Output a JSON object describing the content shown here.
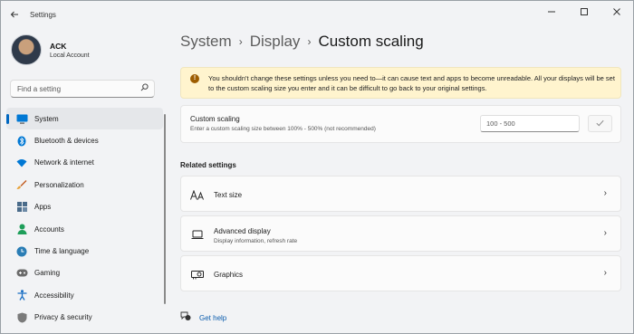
{
  "window": {
    "title": "Settings",
    "back_icon": "back-arrow-icon",
    "controls": [
      "minimize-icon",
      "maximize-icon",
      "close-icon"
    ]
  },
  "profile": {
    "name": "ACK",
    "account_type": "Local Account"
  },
  "search": {
    "placeholder": "Find a setting",
    "icon": "search-icon"
  },
  "sidebar": {
    "items": [
      {
        "label": "System",
        "icon": "monitor-icon",
        "active": true,
        "color": "#0067c0"
      },
      {
        "label": "Bluetooth & devices",
        "icon": "bluetooth-icon",
        "color": "#0078d4"
      },
      {
        "label": "Network & internet",
        "icon": "wifi-icon",
        "color": "#0078d4"
      },
      {
        "label": "Personalization",
        "icon": "brush-icon",
        "color": "#c25b1f"
      },
      {
        "label": "Apps",
        "icon": "apps-icon",
        "color": "#4a6b8a"
      },
      {
        "label": "Accounts",
        "icon": "person-icon",
        "color": "#1e9e5a"
      },
      {
        "label": "Time & language",
        "icon": "globe-clock-icon",
        "color": "#2a7db5"
      },
      {
        "label": "Gaming",
        "icon": "gamepad-icon",
        "color": "#6b6b6b"
      },
      {
        "label": "Accessibility",
        "icon": "accessibility-icon",
        "color": "#1a6fc4"
      },
      {
        "label": "Privacy & security",
        "icon": "shield-icon",
        "color": "#6b6b6b"
      }
    ]
  },
  "breadcrumb": {
    "items": [
      "System",
      "Display",
      "Custom scaling"
    ]
  },
  "warning": {
    "icon": "warning-icon",
    "text": "You shouldn't change these settings unless you need to—it can cause text and apps to become unreadable. All your displays will be set to the custom scaling size you enter and it can be difficult to go back to your original settings."
  },
  "custom_scaling": {
    "title": "Custom scaling",
    "description": "Enter a custom scaling size between 100% - 500% (not recommended)",
    "input_placeholder": "100 - 500",
    "apply_icon": "checkmark-icon"
  },
  "related_settings": {
    "heading": "Related settings",
    "items": [
      {
        "title": "Text size",
        "description": "",
        "icon": "text-size-icon"
      },
      {
        "title": "Advanced display",
        "description": "Display information, refresh rate",
        "icon": "laptop-icon"
      },
      {
        "title": "Graphics",
        "description": "",
        "icon": "graphics-card-icon"
      }
    ]
  },
  "help": {
    "label": "Get help",
    "icon": "help-icon"
  }
}
